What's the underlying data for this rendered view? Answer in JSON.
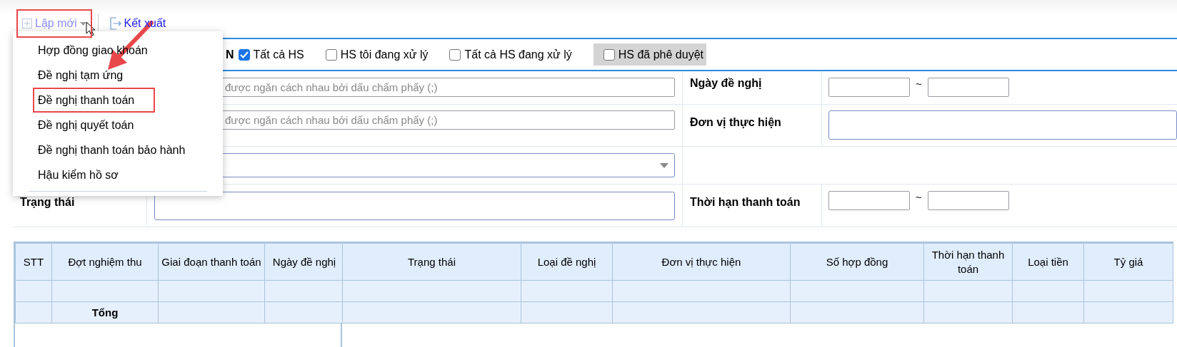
{
  "toolbar": {
    "buttons": [
      {
        "kind": "new",
        "label": "Lập mới",
        "annotated": true
      },
      {
        "kind": "export",
        "label": "Kết xuất",
        "annotated": false
      }
    ]
  },
  "new_menu": {
    "items": [
      {
        "label": "Hợp đồng giao khoán",
        "annotated": false
      },
      {
        "label": "Đề nghị tạm ứng",
        "annotated": false
      },
      {
        "label": "Đề nghị thanh toán",
        "annotated": true
      },
      {
        "label": "Đề nghị quyết toán",
        "annotated": false
      },
      {
        "label": "Đề nghị thanh toán bảo hành",
        "annotated": false
      },
      {
        "label": "Hậu kiểm hồ sơ",
        "annotated": false
      }
    ]
  },
  "filters": {
    "partial_label": "N",
    "checkboxes": [
      {
        "label": "Tất cả HS",
        "checked": true,
        "highlighted": false
      },
      {
        "label": "HS tôi đang xử lý",
        "checked": false,
        "highlighted": false
      },
      {
        "label": "Tất cả HS đang xử lý",
        "checked": false,
        "highlighted": false
      },
      {
        "label": "HS đã phê duyệt",
        "checked": false,
        "highlighted": true
      }
    ],
    "rows": [
      {
        "field": {
          "kind": "text",
          "placeholder": "được ngăn cách nhau bởi dấu chấm phẩy (;)"
        },
        "right_label": "Ngày đề nghị",
        "right_field": {
          "kind": "date_range",
          "separator": "~"
        }
      },
      {
        "field": {
          "kind": "text",
          "placeholder": "được ngăn cách nhau bởi dấu chấm phẩy (;)"
        },
        "right_label": "Đơn vị thực hiện",
        "right_field": {
          "kind": "box"
        }
      },
      {
        "field": {
          "kind": "select"
        }
      },
      {
        "label": "Trạng thái",
        "field": {
          "kind": "box"
        },
        "right_label": "Thời hạn thanh toán",
        "right_field": {
          "kind": "date_range",
          "separator": "~"
        }
      }
    ]
  },
  "table": {
    "frozen_columns": [
      "STT",
      "Đợt nghiệm thu",
      "Giai đoạn thanh toán",
      "Ngày đề nghị"
    ],
    "columns": [
      "Trạng thái",
      "Loại đề nghị",
      "Đơn vị thực hiện",
      "Số hợp đồng",
      "Thời hạn thanh toán",
      "Loại tiền",
      "Tỷ giá"
    ],
    "rows": [
      {
        "kind": "blank"
      },
      {
        "kind": "total",
        "label": "Tổng"
      }
    ]
  }
}
